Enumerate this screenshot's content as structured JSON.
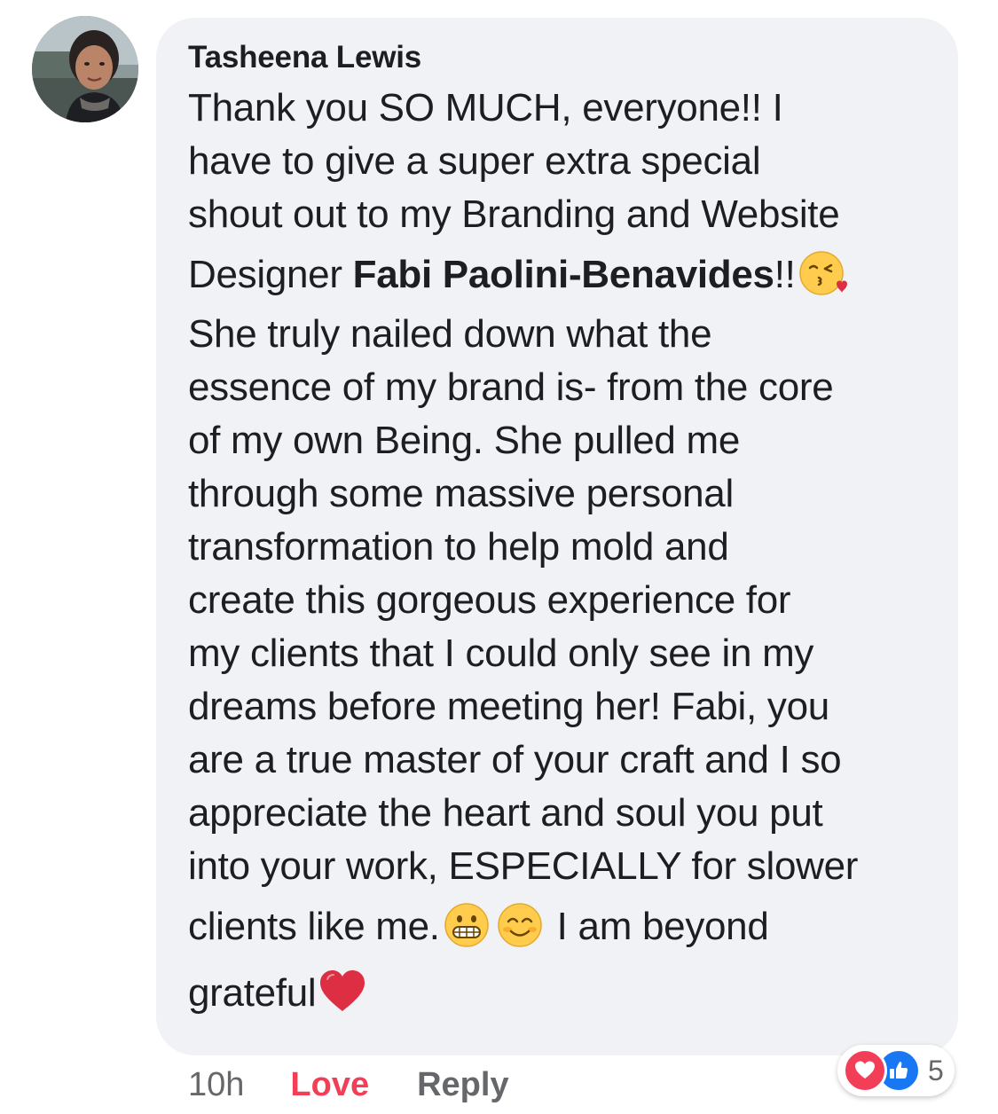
{
  "comment": {
    "author": "Tasheena Lewis",
    "text_lines": [
      "Thank you SO MUCH, everyone!! I",
      "have to give a super extra special",
      "shout out to my Branding and Website",
      "Designer ",
      "Fabi Paolini-Benavides",
      "!!",
      "She truly nailed down what the",
      "essence of my brand is- from the core",
      "of my own Being. She pulled me",
      "through some massive personal",
      "transformation to help mold and",
      "create this gorgeous experience for",
      "my clients that I could only see in my",
      "dreams before meeting her! Fabi, you",
      "are a true master of your craft and I so",
      "appreciate the heart and soul you put",
      "into your work, ESPECIALLY for slower",
      "clients like me.",
      " I am beyond",
      "grateful"
    ],
    "emojis": {
      "kiss": "face-blowing-kiss-emoji",
      "grimace": "grimacing-face-emoji",
      "smile": "smiling-face-emoji",
      "heart": "red-heart-emoji"
    }
  },
  "actions": {
    "timestamp": "10h",
    "love_label": "Love",
    "reply_label": "Reply"
  },
  "reactions": {
    "icons": [
      "love-reaction-icon",
      "like-reaction-icon"
    ],
    "count": "5"
  },
  "colors": {
    "bubble": "#f0f2f5",
    "love": "#f33e58",
    "like": "#1877f2",
    "muted": "#65676b"
  }
}
